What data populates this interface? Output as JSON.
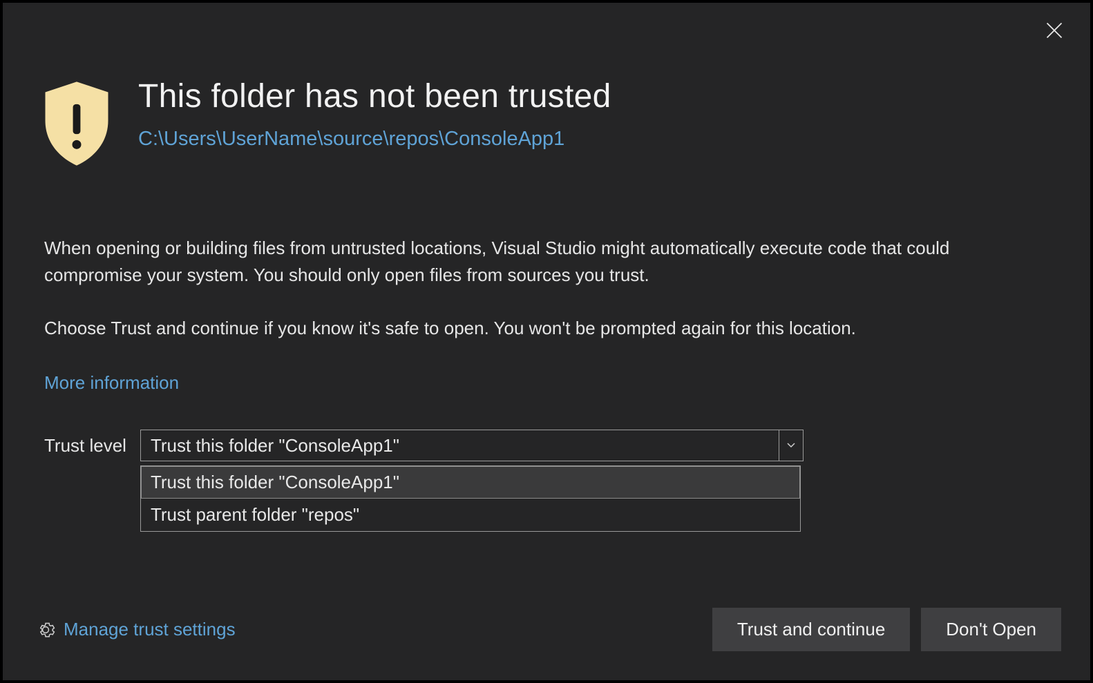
{
  "header": {
    "title": "This folder has not been trusted",
    "path": "C:\\Users\\UserName\\source\\repos\\ConsoleApp1"
  },
  "body": {
    "p1": "When opening or building files from untrusted locations, Visual Studio might automatically execute code that could compromise your system. You should only open files from sources you trust.",
    "p2": "Choose Trust and continue if you know it's safe to open. You won't be prompted again for this location.",
    "more_info": "More information"
  },
  "trust": {
    "label": "Trust level",
    "selected": "Trust this folder \"ConsoleApp1\"",
    "options": [
      "Trust this folder \"ConsoleApp1\"",
      "Trust parent folder \"repos\""
    ]
  },
  "footer": {
    "manage": "Manage trust settings",
    "trust_btn": "Trust and continue",
    "dont_open_btn": "Don't Open"
  }
}
